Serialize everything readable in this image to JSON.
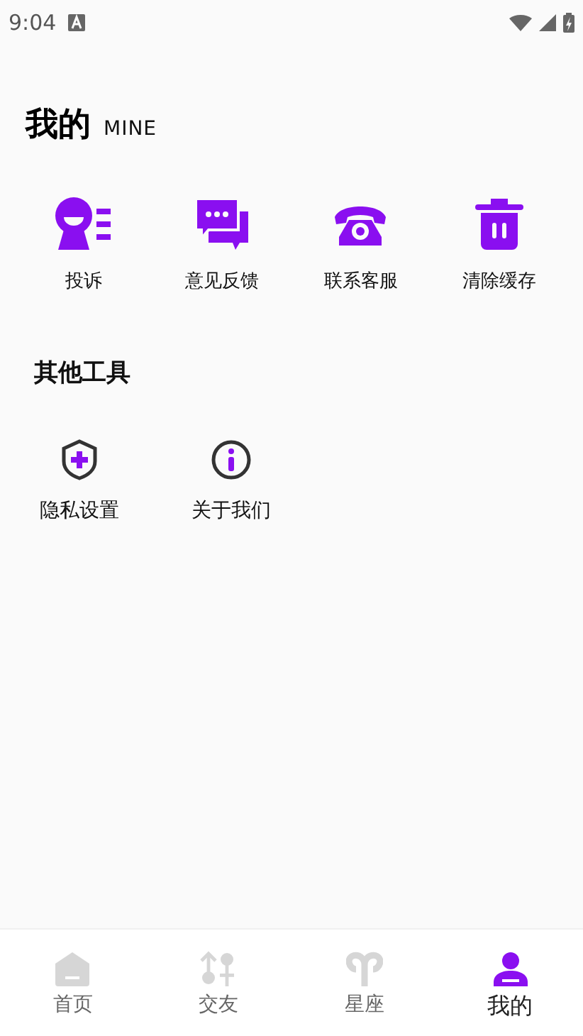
{
  "status_bar": {
    "time": "9:04"
  },
  "header": {
    "title": "我的",
    "subtitle": "MINE"
  },
  "services": [
    {
      "kind": "complaint",
      "label": "投诉"
    },
    {
      "kind": "feedback",
      "label": "意见反馈"
    },
    {
      "kind": "phone",
      "label": "联系客服"
    },
    {
      "kind": "trash",
      "label": "清除缓存"
    }
  ],
  "tools_title": "其他工具",
  "tools": [
    {
      "kind": "shield",
      "label": "隐私设置"
    },
    {
      "kind": "info",
      "label": "关于我们"
    }
  ],
  "bottom_nav": [
    {
      "kind": "home",
      "label": "首页",
      "selected": false
    },
    {
      "kind": "friends",
      "label": "交友",
      "selected": false
    },
    {
      "kind": "aries",
      "label": "星座",
      "selected": false
    },
    {
      "kind": "person",
      "label": "我的",
      "selected": true
    }
  ]
}
